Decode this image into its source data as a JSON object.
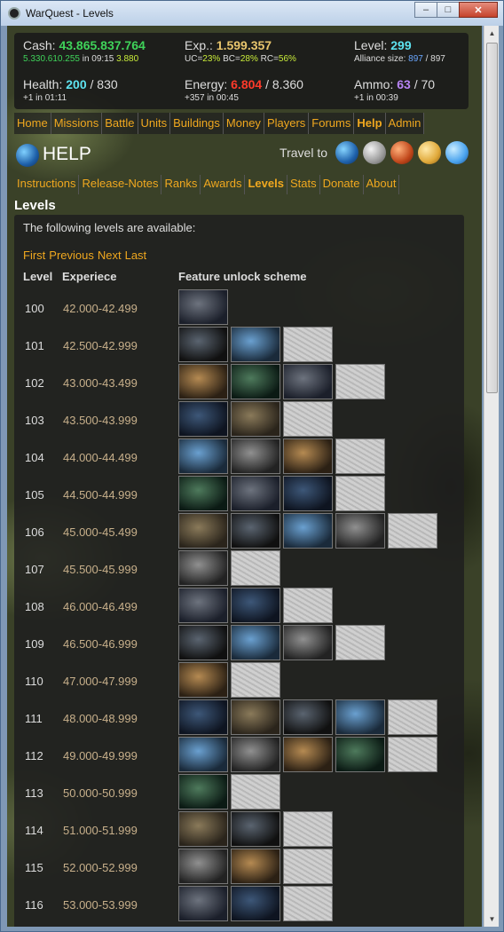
{
  "window": {
    "title": "WarQuest - Levels",
    "minimize": "–",
    "maximize": "□",
    "close": "✕"
  },
  "stats": {
    "cash": {
      "label": "Cash:",
      "value": "43.865.837.764",
      "sub_value": "5.330.610.255",
      "sub_mid": "in 09:15",
      "sub_extra": "3.880"
    },
    "exp": {
      "label": "Exp.:",
      "value": "1.599.357",
      "uc_label": "UC=",
      "uc": "23%",
      "bc_label": "BC=",
      "bc": "28%",
      "rc_label": "RC=",
      "rc": "56%"
    },
    "level": {
      "label": "Level:",
      "value": "299",
      "alliance_label": "Alliance size:",
      "alliance_value": "897",
      "alliance_max": "/ 897"
    },
    "health": {
      "label": "Health:",
      "value": "200",
      "max": "/ 830",
      "sub": "+1 in 01:11"
    },
    "energy": {
      "label": "Energy:",
      "value": "6.804",
      "max": "/ 8.360",
      "sub": "+357 in 00:45"
    },
    "ammo": {
      "label": "Ammo:",
      "value": "63",
      "max": "/ 70",
      "sub": "+1 in 00:39"
    }
  },
  "nav": [
    "Home",
    "Missions",
    "Battle",
    "Units",
    "Buildings",
    "Money",
    "Players",
    "Forums",
    "Help",
    "Admin"
  ],
  "nav_active": "Help",
  "help": {
    "title": "HELP",
    "travel_label": "Travel to"
  },
  "subnav": [
    "Instructions",
    "Release-Notes",
    "Ranks",
    "Awards",
    "Levels",
    "Stats",
    "Donate",
    "About"
  ],
  "subnav_active": "Levels",
  "section_title": "Levels",
  "intro": "The following levels are available:",
  "pager": [
    "First",
    "Previous",
    "Next",
    "Last"
  ],
  "table_headers": {
    "level": "Level",
    "experience": "Experiece",
    "features": "Feature unlock scheme"
  },
  "levels": [
    {
      "level": "100",
      "exp": "42.000-42.499",
      "features": 1
    },
    {
      "level": "101",
      "exp": "42.500-42.999",
      "features": 3
    },
    {
      "level": "102",
      "exp": "43.000-43.499",
      "features": 4
    },
    {
      "level": "103",
      "exp": "43.500-43.999",
      "features": 3
    },
    {
      "level": "104",
      "exp": "44.000-44.499",
      "features": 4
    },
    {
      "level": "105",
      "exp": "44.500-44.999",
      "features": 4
    },
    {
      "level": "106",
      "exp": "45.000-45.499",
      "features": 5
    },
    {
      "level": "107",
      "exp": "45.500-45.999",
      "features": 2
    },
    {
      "level": "108",
      "exp": "46.000-46.499",
      "features": 3
    },
    {
      "level": "109",
      "exp": "46.500-46.999",
      "features": 4
    },
    {
      "level": "110",
      "exp": "47.000-47.999",
      "features": 2
    },
    {
      "level": "111",
      "exp": "48.000-48.999",
      "features": 5
    },
    {
      "level": "112",
      "exp": "49.000-49.999",
      "features": 5
    },
    {
      "level": "113",
      "exp": "50.000-50.999",
      "features": 2
    },
    {
      "level": "114",
      "exp": "51.000-51.999",
      "features": 3
    },
    {
      "level": "115",
      "exp": "52.000-52.999",
      "features": 3
    },
    {
      "level": "116",
      "exp": "53.000-53.999",
      "features": 3
    }
  ]
}
